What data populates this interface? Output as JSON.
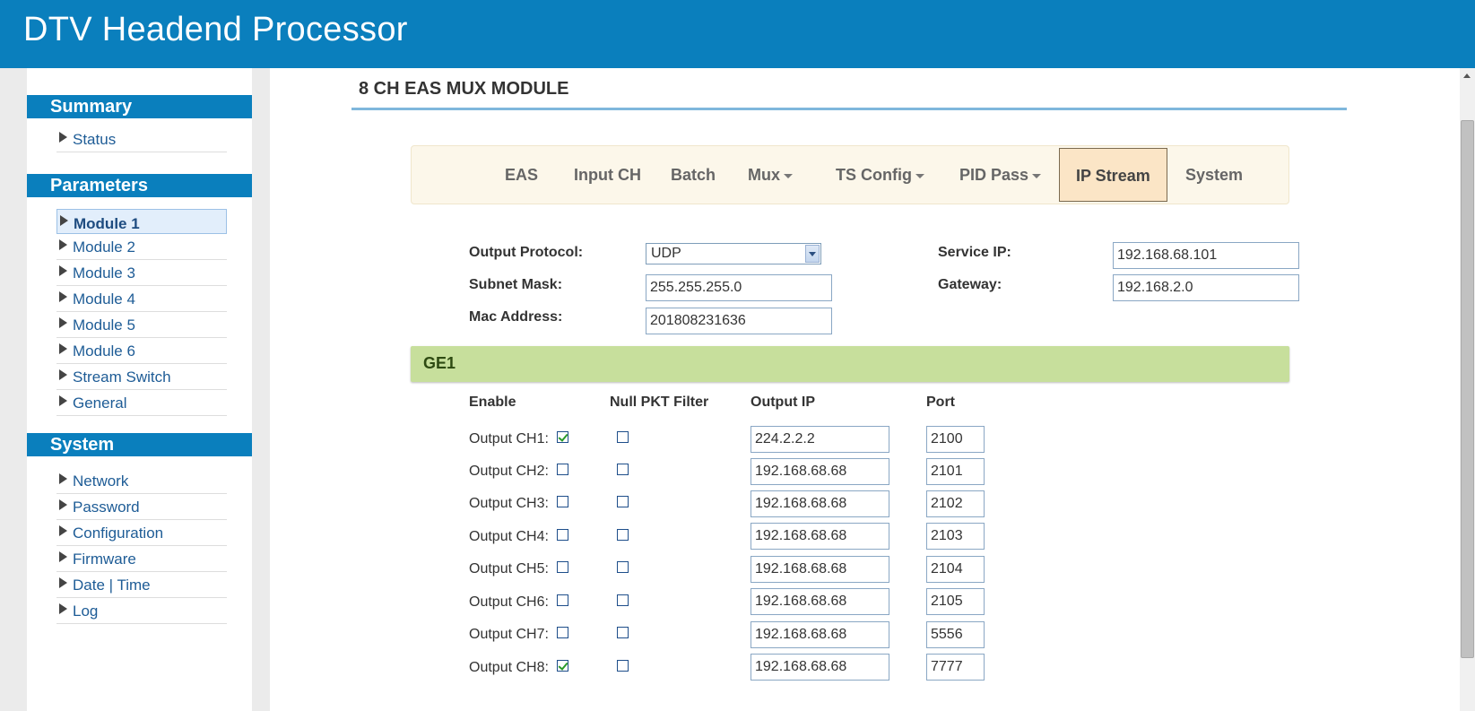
{
  "app": {
    "title": "DTV Headend Processor"
  },
  "sidebar": {
    "summary": {
      "heading": "Summary",
      "items": [
        "Status"
      ]
    },
    "parameters": {
      "heading": "Parameters",
      "items": [
        "Module 1",
        "Module 2",
        "Module 3",
        "Module 4",
        "Module 5",
        "Module 6",
        "Stream Switch",
        "General"
      ],
      "active": "Module 1"
    },
    "system": {
      "heading": "System",
      "items": [
        "Network",
        "Password",
        "Configuration",
        "Firmware",
        "Date | Time",
        "Log"
      ]
    }
  },
  "main": {
    "module_title": "8 CH EAS MUX MODULE",
    "tabs": [
      "EAS",
      "Input CH",
      "Batch",
      "Mux",
      "TS Config",
      "PID Pass",
      "IP Stream",
      "System"
    ],
    "active_tab": "IP Stream",
    "form": {
      "output_protocol_label": "Output Protocol:",
      "output_protocol_value": "UDP",
      "subnet_mask_label": "Subnet Mask:",
      "subnet_mask_value": "255.255.255.0",
      "mac_address_label": "Mac Address:",
      "mac_address_value": "201808231636",
      "service_ip_label": "Service IP:",
      "service_ip_value": "192.168.68.101",
      "gateway_label": "Gateway:",
      "gateway_value": "192.168.2.0"
    },
    "ge1": {
      "label": "GE1",
      "headers": {
        "enable": "Enable",
        "null_pkt": "Null PKT Filter",
        "output_ip": "Output IP",
        "port": "Port"
      },
      "rows": [
        {
          "label": "Output CH1:",
          "enabled": true,
          "null_filter": false,
          "ip": "224.2.2.2",
          "port": "2100"
        },
        {
          "label": "Output CH2:",
          "enabled": false,
          "null_filter": false,
          "ip": "192.168.68.68",
          "port": "2101"
        },
        {
          "label": "Output CH3:",
          "enabled": false,
          "null_filter": false,
          "ip": "192.168.68.68",
          "port": "2102"
        },
        {
          "label": "Output CH4:",
          "enabled": false,
          "null_filter": false,
          "ip": "192.168.68.68",
          "port": "2103"
        },
        {
          "label": "Output CH5:",
          "enabled": false,
          "null_filter": false,
          "ip": "192.168.68.68",
          "port": "2104"
        },
        {
          "label": "Output CH6:",
          "enabled": false,
          "null_filter": false,
          "ip": "192.168.68.68",
          "port": "2105"
        },
        {
          "label": "Output CH7:",
          "enabled": false,
          "null_filter": false,
          "ip": "192.168.68.68",
          "port": "5556"
        },
        {
          "label": "Output CH8:",
          "enabled": true,
          "null_filter": false,
          "ip": "192.168.68.68",
          "port": "7777"
        }
      ]
    }
  },
  "colors": {
    "brand_blue": "#0a7fbd",
    "ge_bar": "#c7df9c",
    "active_tab": "#fbe5c6"
  }
}
